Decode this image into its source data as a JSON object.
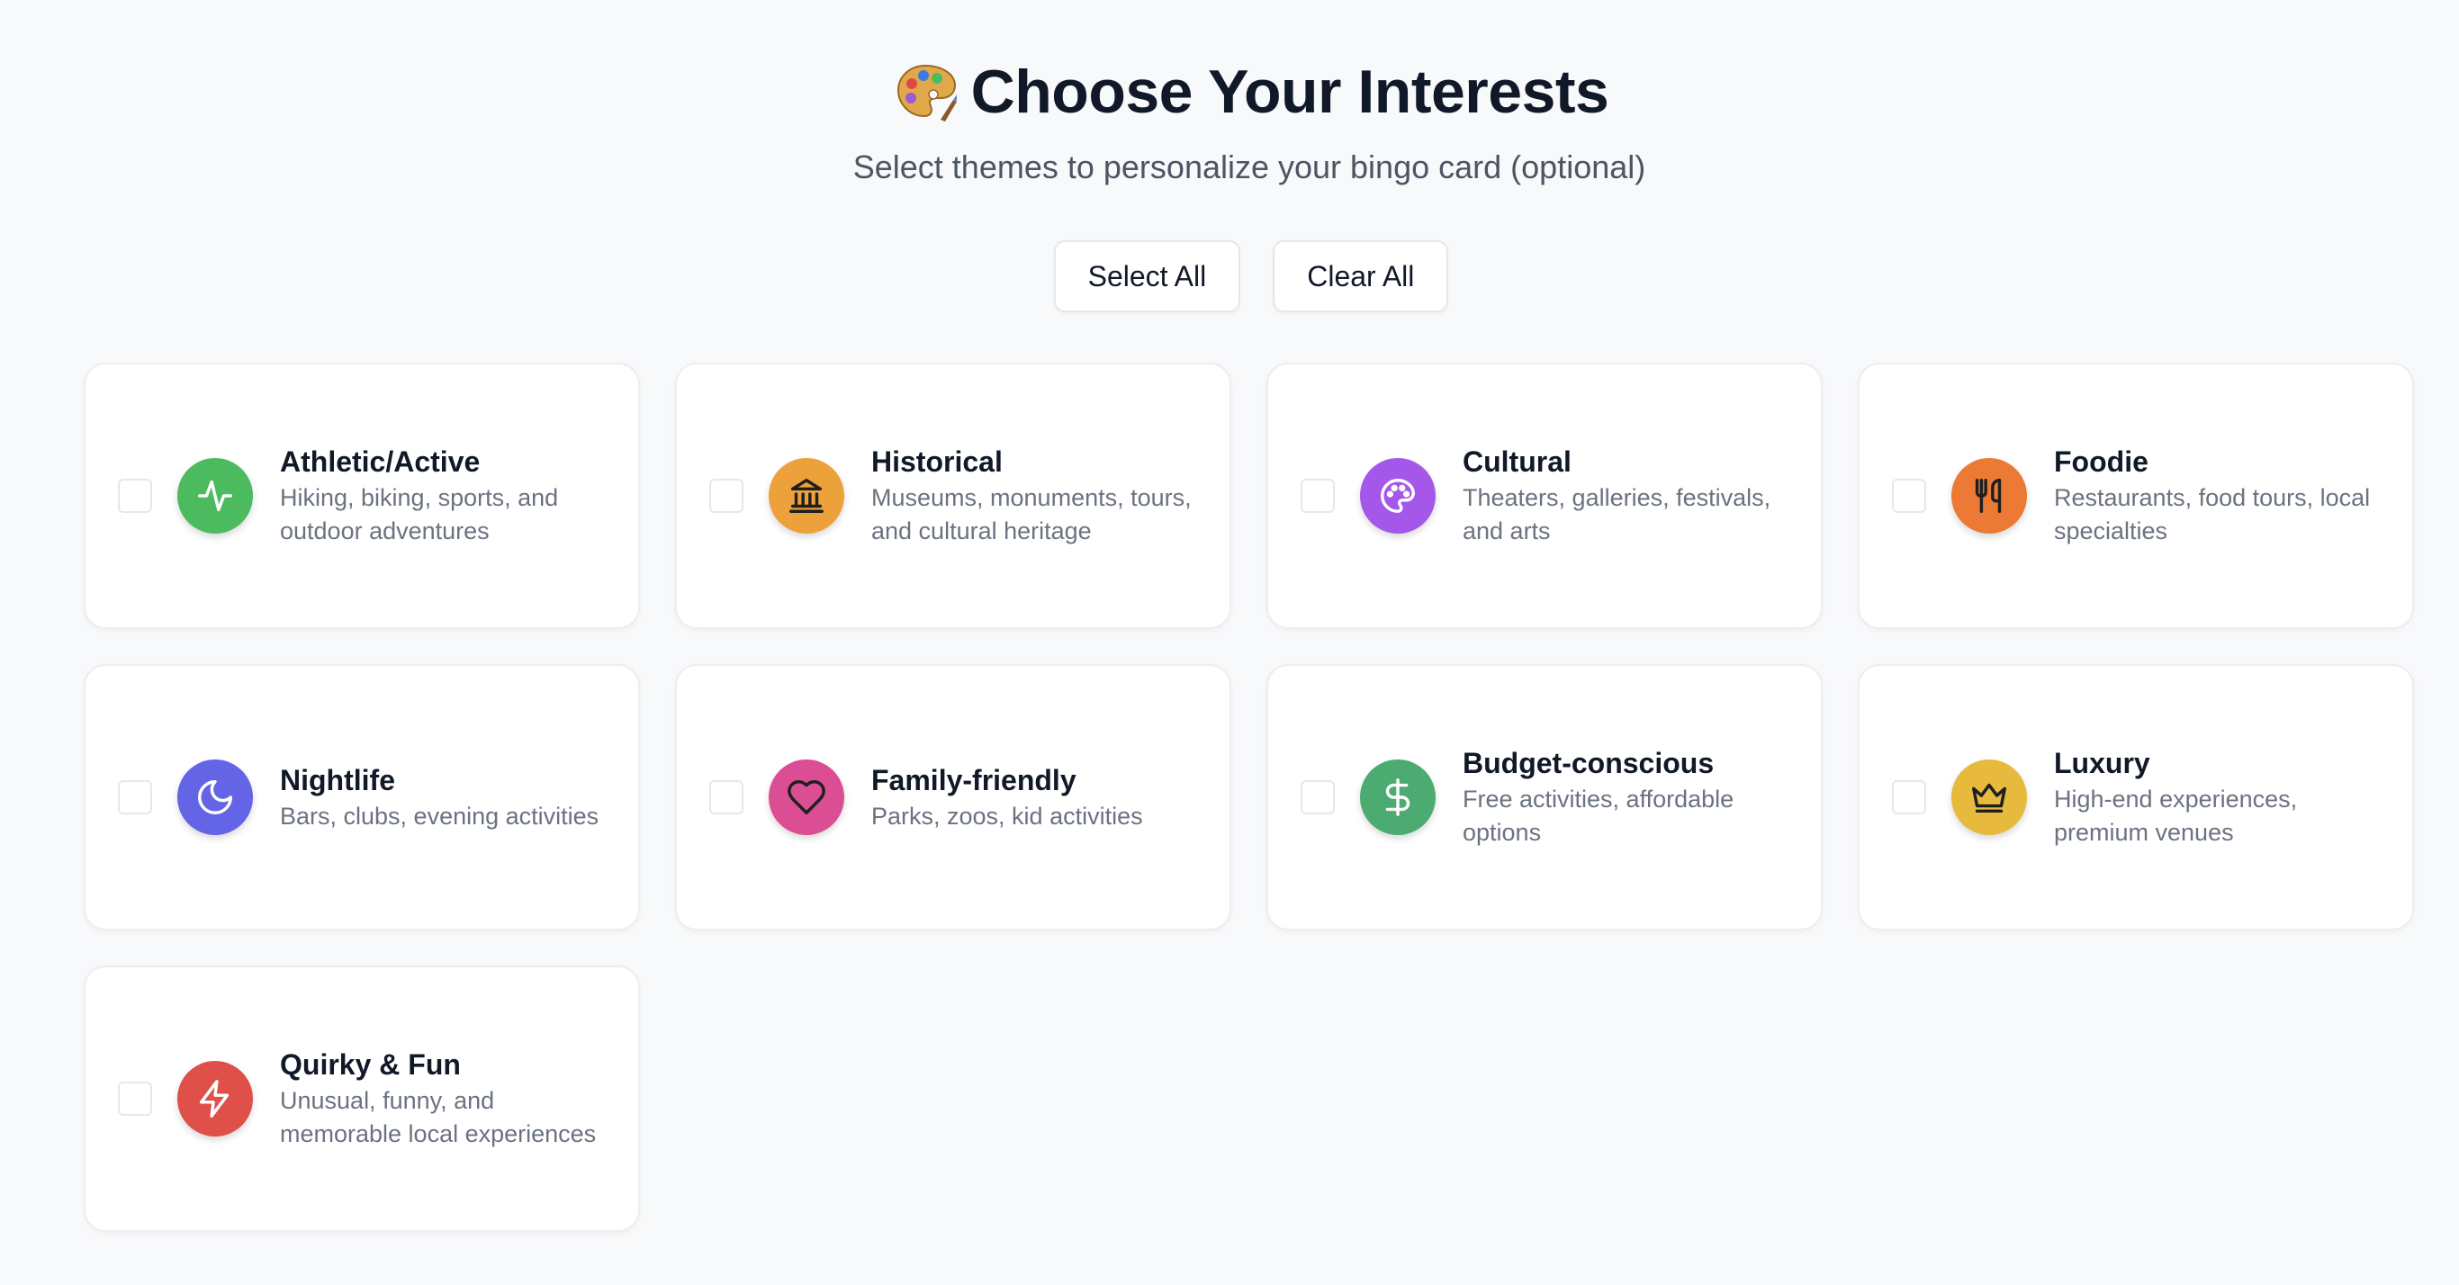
{
  "header": {
    "title": "Choose Your Interests",
    "title_icon": "artist-palette-icon",
    "subtitle": "Select themes to personalize your bingo card (optional)"
  },
  "actions": {
    "select_all_label": "Select All",
    "clear_all_label": "Clear All"
  },
  "interests": [
    {
      "title": "Athletic/Active",
      "description": "Hiking, biking, sports, and outdoor adventures",
      "icon": "activity-pulse-icon",
      "color": "#4cbb5f",
      "checked": false
    },
    {
      "title": "Historical",
      "description": "Museums, monuments, tours, and cultural heritage",
      "icon": "landmark-icon",
      "color": "#eca13a",
      "checked": false
    },
    {
      "title": "Cultural",
      "description": "Theaters, galleries, festivals, and arts",
      "icon": "palette-icon",
      "color": "#a457e8",
      "checked": false
    },
    {
      "title": "Foodie",
      "description": "Restaurants, food tours, local specialties",
      "icon": "utensils-icon",
      "color": "#ec7a35",
      "checked": false
    },
    {
      "title": "Nightlife",
      "description": "Bars, clubs, evening activities",
      "icon": "moon-icon",
      "color": "#6465e6",
      "checked": false
    },
    {
      "title": "Family-friendly",
      "description": "Parks, zoos, kid activities",
      "icon": "heart-icon",
      "color": "#dc4e93",
      "checked": false
    },
    {
      "title": "Budget-conscious",
      "description": "Free activities, affordable options",
      "icon": "dollar-sign-icon",
      "color": "#4bab70",
      "checked": false
    },
    {
      "title": "Luxury",
      "description": "High-end experiences, premium venues",
      "icon": "crown-icon",
      "color": "#e7b93c",
      "checked": false
    },
    {
      "title": "Quirky & Fun",
      "description": "Unusual, funny, and memorable local experiences",
      "icon": "zap-icon",
      "color": "#e0504a",
      "checked": false
    }
  ]
}
